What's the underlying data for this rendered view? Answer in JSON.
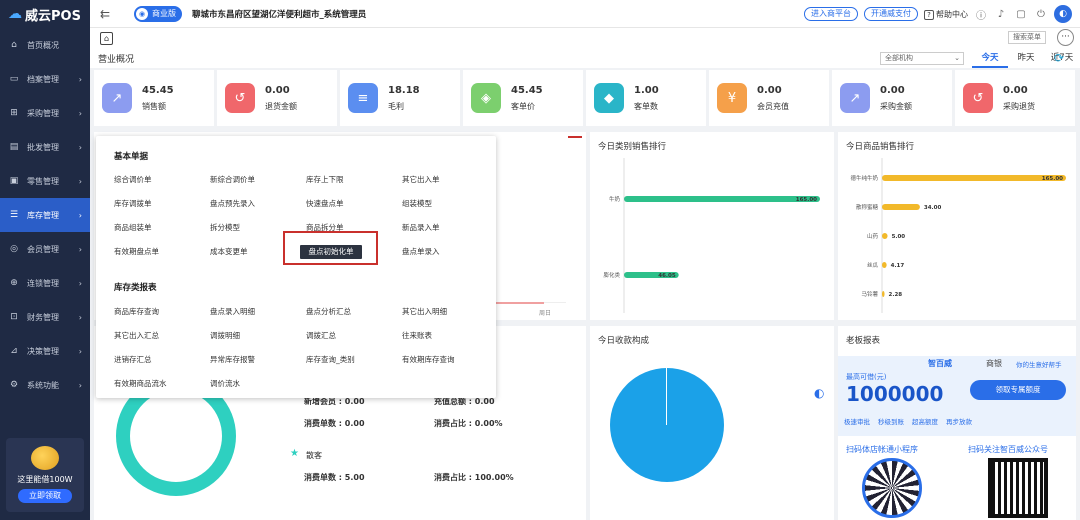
{
  "app": {
    "logo_text": "威云POS"
  },
  "sidebar": {
    "items": [
      {
        "label": "首页概况",
        "icon": "home-icon",
        "glyph": "⌂"
      },
      {
        "label": "档案管理",
        "icon": "folder-icon",
        "glyph": "▭"
      },
      {
        "label": "采购管理",
        "icon": "cart-icon",
        "glyph": "⊞"
      },
      {
        "label": "批发管理",
        "icon": "building-icon",
        "glyph": "▤"
      },
      {
        "label": "零售管理",
        "icon": "shop-icon",
        "glyph": "▣"
      },
      {
        "label": "库存管理",
        "icon": "inventory-icon",
        "glyph": "☰"
      },
      {
        "label": "会员管理",
        "icon": "member-icon",
        "glyph": "◎"
      },
      {
        "label": "连锁管理",
        "icon": "chain-icon",
        "glyph": "⊕"
      },
      {
        "label": "财务管理",
        "icon": "finance-icon",
        "glyph": "⊡"
      },
      {
        "label": "决策管理",
        "icon": "decision-icon",
        "glyph": "⊿"
      },
      {
        "label": "系统功能",
        "icon": "settings-icon",
        "glyph": "⚙"
      }
    ],
    "active_index": 5,
    "promo_text": "这里能借100W",
    "promo_button": "立即领取"
  },
  "topbar": {
    "edition": "商业版",
    "store": "聊城市东昌府区望湖亿洋便利超市_系统管理员",
    "buttons": [
      "进入商平台",
      "开通威支付"
    ],
    "help": "帮助中心"
  },
  "tabbar": {
    "search_menu": "搜索菜单",
    "more": "···"
  },
  "overview": {
    "title": "营业概况",
    "org_select": "全部机构",
    "ranges": [
      "今天",
      "昨天",
      "近7天",
      "本月"
    ],
    "active_range": "今天"
  },
  "stats": [
    {
      "value": "45.45",
      "label": "销售额",
      "color": "#8c9cf0",
      "glyph": "↗",
      "icon": "sales-icon"
    },
    {
      "value": "0.00",
      "label": "退货金额",
      "color": "#f0676b",
      "glyph": "↺",
      "icon": "refund-icon"
    },
    {
      "value": "18.18",
      "label": "毛利",
      "color": "#5b8ef0",
      "glyph": "≡",
      "icon": "profit-icon"
    },
    {
      "value": "45.45",
      "label": "客单价",
      "color": "#7ccf6e",
      "glyph": "◈",
      "icon": "tag-icon"
    },
    {
      "value": "1.00",
      "label": "客单数",
      "color": "#2ab5c8",
      "glyph": "◆",
      "icon": "layers-icon"
    },
    {
      "value": "0.00",
      "label": "会员充值",
      "color": "#f5a04a",
      "glyph": "¥",
      "icon": "moneybag-icon"
    },
    {
      "value": "0.00",
      "label": "采购金额",
      "color": "#8c9cf0",
      "glyph": "↗",
      "icon": "purchase-icon"
    },
    {
      "value": "0.00",
      "label": "采购退货",
      "color": "#f0676b",
      "glyph": "↺",
      "icon": "purchase-return-icon"
    }
  ],
  "panels": {
    "category_rank_title": "今日类别销售排行",
    "product_rank_title": "今日商品销售排行",
    "income_title": "今日收款构成",
    "boss_title": "老板报表"
  },
  "chart_data": [
    {
      "type": "bar",
      "title": "今日类别销售排行",
      "categories": [
        "牛奶",
        "膨化类"
      ],
      "values": [
        165,
        46.05
      ],
      "data_labels": [
        "165.00",
        "46.05"
      ]
    },
    {
      "type": "bar",
      "title": "今日商品销售排行",
      "categories": [
        "德牛纯牛奶",
        "散称蜜糖",
        "山药",
        "丝瓜",
        "马铃薯"
      ],
      "values": [
        165,
        34,
        5,
        4.17,
        2.28
      ],
      "data_labels": [
        "165.00",
        "34.00",
        "5.00",
        "4.17",
        "2.28"
      ]
    }
  ],
  "popup": {
    "sec1": "基本单据",
    "grid1": [
      [
        "综合调价单",
        "新综合调价单",
        "库存上下限",
        "其它出入单"
      ],
      [
        "库存调拨单",
        "盘点预先录入",
        "快速盘点单",
        "组装模型"
      ],
      [
        "商品组装单",
        "拆分模型",
        "商品拆分单",
        "新品录入单"
      ],
      [
        "有效期盘点单",
        "成本变更单",
        "盘点初始化单",
        "盘点单录入"
      ]
    ],
    "sec2": "库存类报表",
    "grid2": [
      [
        "商品库存查询",
        "盘点录入明细",
        "盘点分析汇总",
        "其它出入明细"
      ],
      [
        "其它出入汇总",
        "调拨明细",
        "调拨汇总",
        "往来账表"
      ],
      [
        "进销存汇总",
        "异常库存报警",
        "库存查询_类别",
        "有效期库存查询"
      ],
      [
        "有效期商品流水",
        "调价流水"
      ]
    ]
  },
  "mid": {
    "new_member": "新增会员 : 0.00",
    "recharge": "充值总额 : 0.00",
    "consume_count": "消费单数 : 0.00",
    "consume_ratio": "消费占比 : 0.00%",
    "guest": "散客",
    "guest_count": "消费单数 : 5.00",
    "guest_ratio": "消费占比 : 100.00%",
    "axis_label": "周日"
  },
  "ad": {
    "brand": "智百威",
    "brand2": "商银",
    "slogan": "你的生意好帮手",
    "credit_label": "最高可借(元)",
    "amount": "1000000",
    "cta": "领取专属额度",
    "perks": [
      "极速审批",
      "秒级到账",
      "超高额度",
      "再步放款"
    ],
    "qr1": "扫码体店帐通小程序",
    "qr2": "扫码关注智百威公众号"
  }
}
